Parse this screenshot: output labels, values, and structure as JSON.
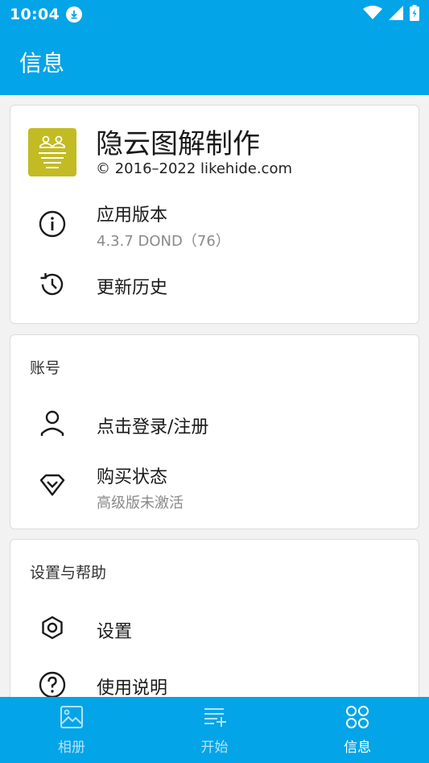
{
  "status_bar": {
    "time": "10:04"
  },
  "app_bar": {
    "title": "信息"
  },
  "app_card": {
    "name": "隐云图解制作",
    "copyright": "© 2016–2022 likehide.com",
    "version_label": "应用版本",
    "version_value": "4.3.7 DOND（76）",
    "history_label": "更新历史"
  },
  "account_card": {
    "section_title": "账号",
    "login_label": "点击登录/注册",
    "purchase_label": "购买状态",
    "purchase_value": "高级版未激活"
  },
  "settings_card": {
    "section_title": "设置与帮助",
    "settings_label": "设置",
    "help_label": "使用说明"
  },
  "bottom_nav": {
    "items": [
      {
        "label": "相册",
        "icon": "gallery-icon",
        "active": false
      },
      {
        "label": "开始",
        "icon": "playlist-add-icon",
        "active": false
      },
      {
        "label": "信息",
        "icon": "apps-grid-icon",
        "active": true
      }
    ]
  },
  "colors": {
    "primary": "#03a4e8",
    "logo": "#c2bb24"
  }
}
